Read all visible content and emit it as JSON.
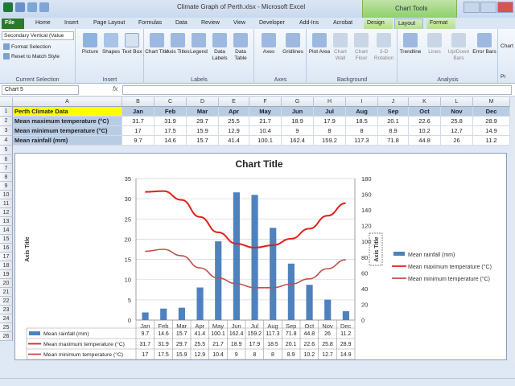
{
  "window": {
    "title": "Climate Graph of Perth.xlsx - Microsoft Excel",
    "context_tab": "Chart Tools"
  },
  "tabs": [
    "File",
    "Home",
    "Insert",
    "Page Layout",
    "Formulas",
    "Data",
    "Review",
    "View",
    "Developer",
    "Add-Ins",
    "Acrobat",
    "Design",
    "Layout",
    "Format"
  ],
  "active_tab": "Layout",
  "ribbon": {
    "current_selection": {
      "combo_value": "Secondary Vertical (Value",
      "format_selection": "Format Selection",
      "reset": "Reset to Match Style",
      "label": "Current Selection"
    },
    "insert": {
      "label": "Insert",
      "buttons": [
        "Picture",
        "Shapes",
        "Text Box"
      ]
    },
    "labels": {
      "label": "Labels",
      "buttons": [
        "Chart Title",
        "Axis Titles",
        "Legend",
        "Data Labels",
        "Data Table"
      ]
    },
    "axes": {
      "label": "Axes",
      "buttons": [
        "Axes",
        "Gridlines"
      ]
    },
    "background": {
      "label": "Background",
      "buttons": [
        "Plot Area",
        "Chart Wall",
        "Chart Floor",
        "3-D Rotation"
      ]
    },
    "analysis": {
      "label": "Analysis",
      "buttons": [
        "Trendline",
        "Lines",
        "Up/Down Bars",
        "Error Bars"
      ]
    },
    "properties": [
      "Chart",
      "Pr"
    ]
  },
  "formula_bar": {
    "name_box": "Chart 5",
    "fx": "fx"
  },
  "columns": [
    "A",
    "B",
    "C",
    "D",
    "E",
    "F",
    "G",
    "H",
    "I",
    "J",
    "K",
    "L",
    "M"
  ],
  "rows": [
    "1",
    "2",
    "3",
    "4",
    "5",
    "6",
    "7",
    "8",
    "9",
    "10",
    "11",
    "12",
    "13",
    "14",
    "15",
    "16",
    "17",
    "18",
    "19",
    "20",
    "21",
    "22",
    "23",
    "24",
    "25",
    "26"
  ],
  "sheet": {
    "header_label": "Perth Climate Data",
    "months": [
      "Jan",
      "Feb",
      "Mar",
      "Apr",
      "May",
      "Jun",
      "Jul",
      "Aug",
      "Sep",
      "Oct",
      "Nov",
      "Dec"
    ],
    "rows": [
      {
        "label": "Mean maximum temperature (°C)",
        "values": [
          "31.7",
          "31.9",
          "29.7",
          "25.5",
          "21.7",
          "18.9",
          "17.9",
          "18.5",
          "20.1",
          "22.6",
          "25.8",
          "28.9"
        ]
      },
      {
        "label": "Mean minimum temperature (°C)",
        "values": [
          "17",
          "17.5",
          "15.9",
          "12.9",
          "10.4",
          "9",
          "8",
          "8",
          "8.9",
          "10.2",
          "12.7",
          "14.9"
        ]
      },
      {
        "label": "Mean rainfall (mm)",
        "values": [
          "9.7",
          "14.6",
          "15.7",
          "41.4",
          "100.1",
          "162.4",
          "159.2",
          "117.3",
          "71.8",
          "44.8",
          "26",
          "11.2"
        ]
      }
    ]
  },
  "chart_data": {
    "type": "bar",
    "title": "Chart Title",
    "ylabel": "Axis Title",
    "y2label": "Axis Title",
    "categories": [
      "Jan",
      "Feb",
      "Mar",
      "Apr",
      "May",
      "Jun",
      "Jul",
      "Aug",
      "Sep",
      "Oct",
      "Nov",
      "Dec"
    ],
    "ylim": [
      0,
      35
    ],
    "y_ticks": [
      "0",
      "5",
      "10",
      "15",
      "20",
      "25",
      "30",
      "35"
    ],
    "y2lim": [
      0,
      180
    ],
    "y2_ticks": [
      "0",
      "20",
      "40",
      "60",
      "80",
      "100",
      "120",
      "140",
      "160",
      "180"
    ],
    "legend_position": "right",
    "series": [
      {
        "name": "Mean rainfall (mm)",
        "kind": "bar",
        "axis": "secondary",
        "color": "#4f81bd",
        "values": [
          9.7,
          14.6,
          15.7,
          41.4,
          100.1,
          162.4,
          159.2,
          117.3,
          71.8,
          44.8,
          26,
          11.2
        ],
        "labels": [
          "9.7",
          "14.6",
          "15.7",
          "41.4",
          "100.1",
          "162.4",
          "159.2",
          "117.3",
          "71.8",
          "44.8",
          "26",
          "11.2"
        ]
      },
      {
        "name": "Mean maximum temperature (°C)",
        "kind": "line",
        "axis": "primary",
        "color": "#e0201b",
        "values": [
          31.7,
          31.9,
          29.7,
          25.5,
          21.7,
          18.9,
          17.9,
          18.5,
          20.1,
          22.6,
          25.8,
          28.9
        ],
        "labels": [
          "31.7",
          "31.9",
          "29.7",
          "25.5",
          "21.7",
          "18.9",
          "17.9",
          "18.5",
          "20.1",
          "22.6",
          "25.8",
          "28.9"
        ]
      },
      {
        "name": "Mean minimum temperature (°C)",
        "kind": "line",
        "axis": "primary",
        "color": "#c0504d",
        "values": [
          17,
          17.5,
          15.9,
          12.9,
          10.4,
          9,
          8,
          8,
          8.9,
          10.2,
          12.7,
          14.9
        ],
        "labels": [
          "17",
          "17.5",
          "15.9",
          "12.9",
          "10.4",
          "9",
          "8",
          "8",
          "8.9",
          "10.2",
          "12.7",
          "14.9"
        ]
      }
    ]
  }
}
